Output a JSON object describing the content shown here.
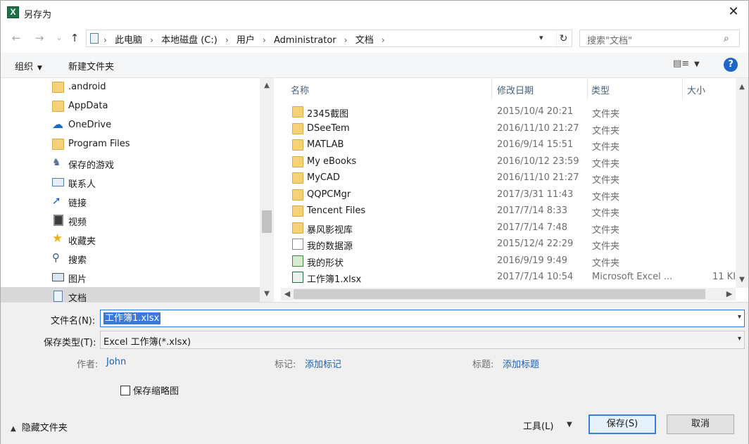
{
  "window": {
    "title": "另存为",
    "app_icon_letter": "X"
  },
  "nav": {
    "back": "←",
    "forward": "→",
    "recent": "⌄",
    "up": "↑"
  },
  "address": {
    "crumbs": [
      "此电脑",
      "本地磁盘 (C:)",
      "用户",
      "Administrator",
      "文档"
    ],
    "separator": "›"
  },
  "search": {
    "placeholder": "搜索\"文档\""
  },
  "toolbar": {
    "organize": "组织",
    "new_folder": "新建文件夹"
  },
  "sidebar": {
    "items": [
      {
        "label": ".android",
        "icon": "folder-icon"
      },
      {
        "label": "AppData",
        "icon": "folder-icon"
      },
      {
        "label": "OneDrive",
        "icon": "cloud-icon"
      },
      {
        "label": "Program Files",
        "icon": "folder-icon"
      },
      {
        "label": "保存的游戏",
        "icon": "games-icon"
      },
      {
        "label": "联系人",
        "icon": "contacts-icon"
      },
      {
        "label": "链接",
        "icon": "link-icon"
      },
      {
        "label": "视频",
        "icon": "video-icon"
      },
      {
        "label": "收藏夹",
        "icon": "star-icon"
      },
      {
        "label": "搜索",
        "icon": "search-icon"
      },
      {
        "label": "图片",
        "icon": "picture-icon"
      },
      {
        "label": "文档",
        "icon": "document-icon"
      }
    ]
  },
  "files": {
    "columns": {
      "name": "名称",
      "date": "修改日期",
      "type": "类型",
      "size": "大小"
    },
    "rows": [
      {
        "name": "2345截图",
        "date": "2015/10/4 20:21",
        "type": "文件夹",
        "size": "",
        "icon": "folder-icon"
      },
      {
        "name": "DSeeTem",
        "date": "2016/11/10 21:27",
        "type": "文件夹",
        "size": "",
        "icon": "folder-icon"
      },
      {
        "name": "MATLAB",
        "date": "2016/9/14 15:51",
        "type": "文件夹",
        "size": "",
        "icon": "folder-icon"
      },
      {
        "name": "My eBooks",
        "date": "2016/10/12 23:59",
        "type": "文件夹",
        "size": "",
        "icon": "folder-icon"
      },
      {
        "name": "MyCAD",
        "date": "2016/11/10 21:27",
        "type": "文件夹",
        "size": "",
        "icon": "folder-icon"
      },
      {
        "name": "QQPCMgr",
        "date": "2017/3/31 11:43",
        "type": "文件夹",
        "size": "",
        "icon": "folder-icon"
      },
      {
        "name": "Tencent Files",
        "date": "2017/7/14 8:33",
        "type": "文件夹",
        "size": "",
        "icon": "folder-icon"
      },
      {
        "name": "暴风影视库",
        "date": "2017/7/14 7:48",
        "type": "文件夹",
        "size": "",
        "icon": "folder-icon"
      },
      {
        "name": "我的数据源",
        "date": "2015/12/4 22:29",
        "type": "文件夹",
        "size": "",
        "icon": "data-source-icon"
      },
      {
        "name": "我的形状",
        "date": "2016/9/19 9:49",
        "type": "文件夹",
        "size": "",
        "icon": "shapes-icon"
      },
      {
        "name": "工作簿1.xlsx",
        "date": "2017/7/14 10:54",
        "type": "Microsoft Excel ...",
        "size": "11 KI",
        "icon": "excel-file-icon"
      }
    ]
  },
  "form": {
    "filename_label": "文件名(N):",
    "filename_value": "工作簿1.xlsx",
    "filetype_label": "保存类型(T):",
    "filetype_value": "Excel 工作簿(*.xlsx)",
    "author_label": "作者:",
    "author_value": "John",
    "tags_label": "标记:",
    "tags_value": "添加标记",
    "title_label": "标题:",
    "title_value": "添加标题",
    "thumbnail_label": "保存缩略图"
  },
  "footer": {
    "hide_folders": "隐藏文件夹",
    "tools": "工具(L)",
    "save": "保存(S)",
    "cancel": "取消"
  },
  "colors": {
    "accent": "#3b7fd8",
    "link": "#1f5fb0",
    "excel_green": "#1e7145",
    "folder": "#f5d27a"
  }
}
